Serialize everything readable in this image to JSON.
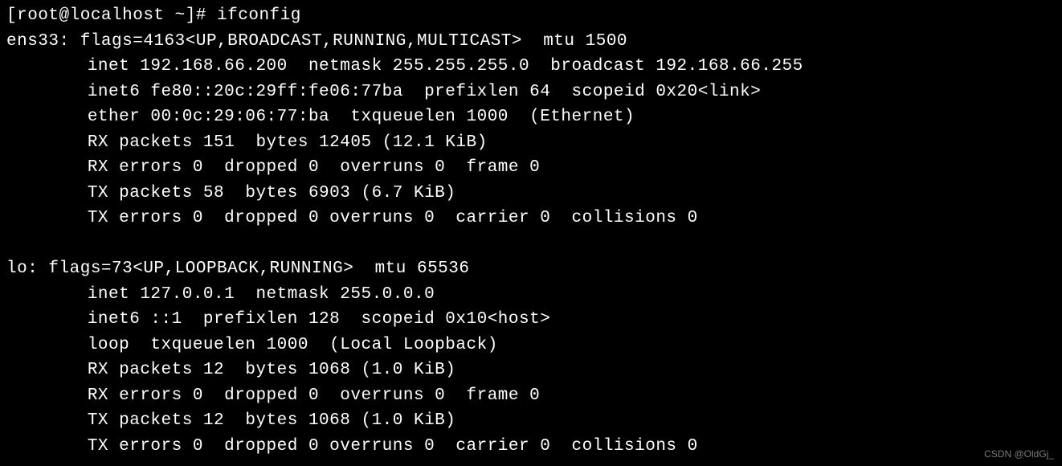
{
  "prompt": "[root@localhost ~]# ifconfig",
  "interfaces": {
    "ens33": {
      "header": "ens33: flags=4163<UP,BROADCAST,RUNNING,MULTICAST>  mtu 1500",
      "inet": "inet 192.168.66.200  netmask 255.255.255.0  broadcast 192.168.66.255",
      "inet6": "inet6 fe80::20c:29ff:fe06:77ba  prefixlen 64  scopeid 0x20<link>",
      "ether": "ether 00:0c:29:06:77:ba  txqueuelen 1000  (Ethernet)",
      "rx_packets": "RX packets 151  bytes 12405 (12.1 KiB)",
      "rx_errors": "RX errors 0  dropped 0  overruns 0  frame 0",
      "tx_packets": "TX packets 58  bytes 6903 (6.7 KiB)",
      "tx_errors": "TX errors 0  dropped 0 overruns 0  carrier 0  collisions 0"
    },
    "lo": {
      "header": "lo: flags=73<UP,LOOPBACK,RUNNING>  mtu 65536",
      "inet": "inet 127.0.0.1  netmask 255.0.0.0",
      "inet6": "inet6 ::1  prefixlen 128  scopeid 0x10<host>",
      "loop": "loop  txqueuelen 1000  (Local Loopback)",
      "rx_packets": "RX packets 12  bytes 1068 (1.0 KiB)",
      "rx_errors": "RX errors 0  dropped 0  overruns 0  frame 0",
      "tx_packets": "TX packets 12  bytes 1068 (1.0 KiB)",
      "tx_errors": "TX errors 0  dropped 0 overruns 0  carrier 0  collisions 0"
    }
  },
  "watermark": "CSDN @OldGj_"
}
